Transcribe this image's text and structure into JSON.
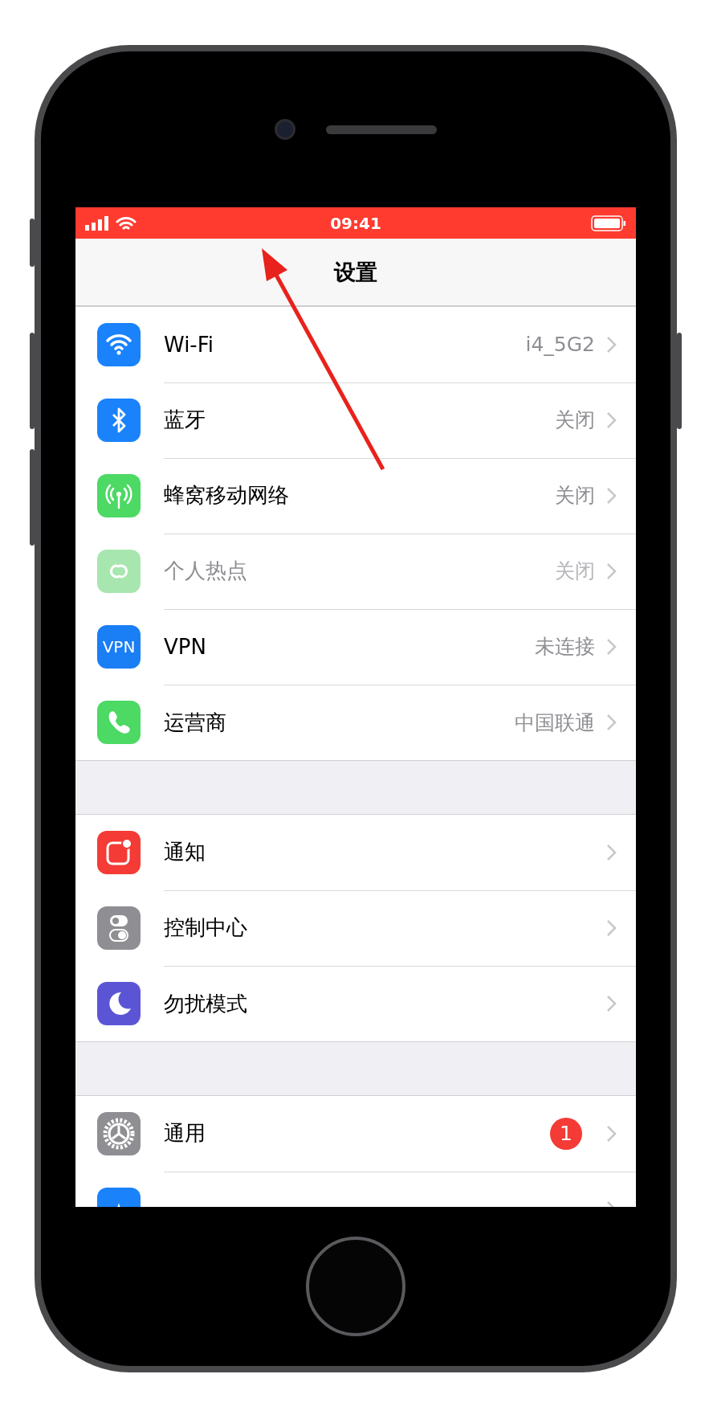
{
  "status_bar": {
    "time": "09:41"
  },
  "nav": {
    "title": "设置"
  },
  "groups": [
    {
      "items": [
        {
          "kind": "wifi",
          "label": "Wi-Fi",
          "value": "i4_5G2",
          "color": "#1a82fb",
          "disabled": false
        },
        {
          "kind": "bluetooth",
          "label": "蓝牙",
          "value": "关闭",
          "color": "#1a82fb",
          "disabled": false
        },
        {
          "kind": "cellular",
          "label": "蜂窝移动网络",
          "value": "关闭",
          "color": "#4cd964",
          "disabled": false
        },
        {
          "kind": "hotspot",
          "label": "个人热点",
          "value": "关闭",
          "color": "#a8e6b0",
          "disabled": true
        },
        {
          "kind": "vpn",
          "label": "VPN",
          "icon_text": "VPN",
          "value": "未连接",
          "color": "#1a7ef5",
          "disabled": false
        },
        {
          "kind": "phone",
          "label": "运营商",
          "value": "中国联通",
          "color": "#4cd964",
          "disabled": false
        }
      ]
    },
    {
      "items": [
        {
          "kind": "notifications",
          "label": "通知",
          "color": "#f43b35",
          "disabled": false
        },
        {
          "kind": "control",
          "label": "控制中心",
          "color": "#8e8e93",
          "disabled": false
        },
        {
          "kind": "moon",
          "label": "勿扰模式",
          "color": "#5b55d6",
          "disabled": false
        }
      ]
    },
    {
      "items": [
        {
          "kind": "gear",
          "label": "通用",
          "badge": "1",
          "color": "#8e8e93",
          "disabled": false
        },
        {
          "kind": "display",
          "color": "#1a82fb"
        }
      ]
    }
  ]
}
